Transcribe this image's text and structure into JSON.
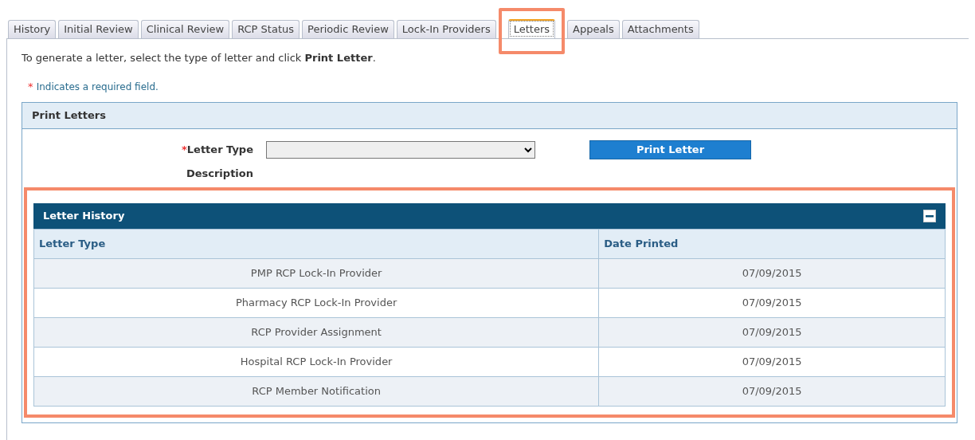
{
  "tabs": [
    {
      "label": "History",
      "selected": false,
      "highlighted": false
    },
    {
      "label": "Initial Review",
      "selected": false,
      "highlighted": false
    },
    {
      "label": "Clinical Review",
      "selected": false,
      "highlighted": false
    },
    {
      "label": "RCP Status",
      "selected": false,
      "highlighted": false
    },
    {
      "label": "Periodic Review",
      "selected": false,
      "highlighted": false
    },
    {
      "label": "Lock-In Providers",
      "selected": false,
      "highlighted": false
    },
    {
      "label": "Letters",
      "selected": true,
      "highlighted": true
    },
    {
      "label": "Appeals",
      "selected": false,
      "highlighted": false
    },
    {
      "label": "Attachments",
      "selected": false,
      "highlighted": false
    }
  ],
  "instructions": "To generate a letter, select the type of letter and click **Print Letter**.",
  "required_note": {
    "marker": "*",
    "text": "Indicates a required field."
  },
  "print_letters": {
    "title": "Print Letters",
    "letter_type": {
      "marker": "*",
      "label": "Letter Type"
    },
    "description_label": "Description",
    "button": "Print Letter"
  },
  "letter_history": {
    "title": "Letter History",
    "expanded": true,
    "highlighted": true,
    "columns": [
      "Letter Type",
      "Date Printed"
    ],
    "rows": [
      [
        "PMP RCP Lock-In Provider",
        "07/09/2015"
      ],
      [
        "Pharmacy RCP Lock-In Provider",
        "07/09/2015"
      ],
      [
        "RCP Provider Assignment",
        "07/09/2015"
      ],
      [
        "Hospital RCP Lock-In Provider",
        "07/09/2015"
      ],
      [
        "RCP Member Notification",
        "07/09/2015"
      ]
    ]
  }
}
